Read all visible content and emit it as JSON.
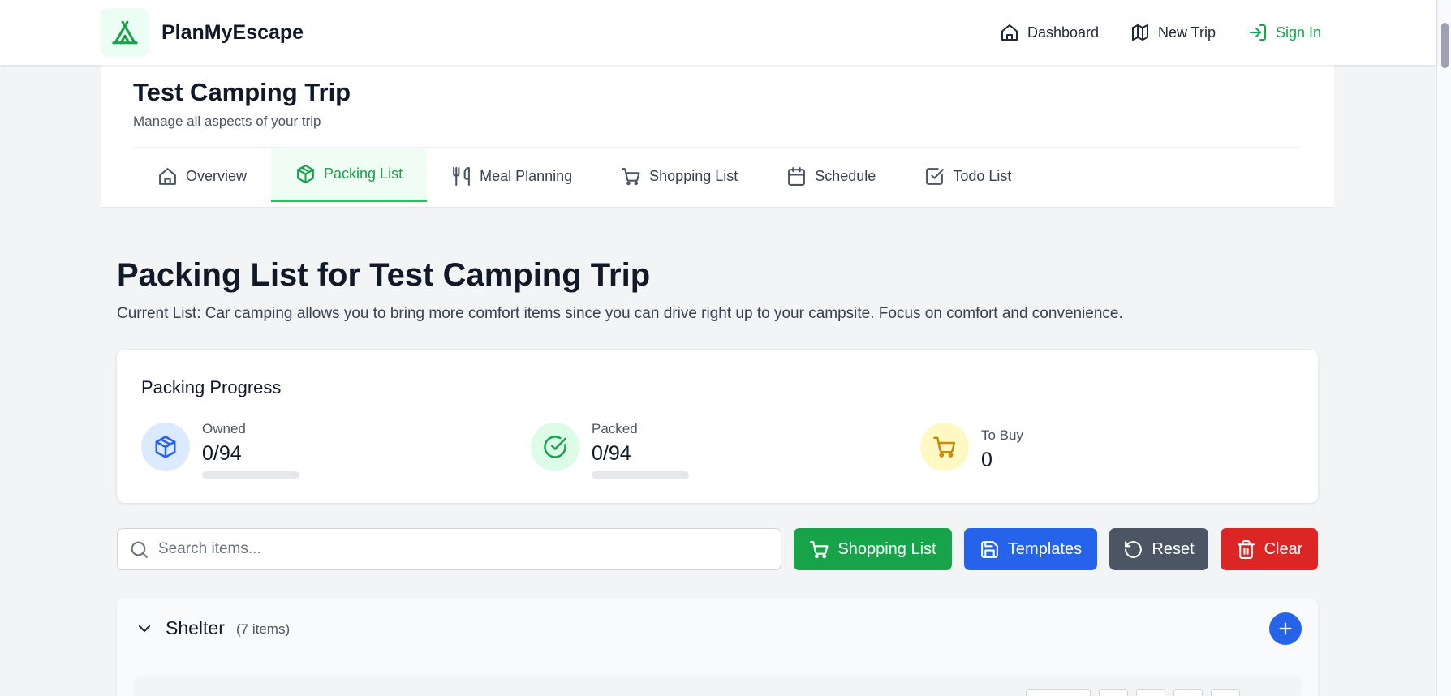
{
  "header": {
    "brand": "PlanMyEscape",
    "nav": [
      {
        "label": "Dashboard",
        "icon": "home-icon"
      },
      {
        "label": "New Trip",
        "icon": "map-icon"
      },
      {
        "label": "Sign In",
        "icon": "sign-in-icon"
      }
    ]
  },
  "trip": {
    "title": "Test Camping Trip",
    "subtitle": "Manage all aspects of your trip",
    "tabs": [
      {
        "label": "Overview",
        "icon": "home-icon"
      },
      {
        "label": "Packing List",
        "icon": "package-icon",
        "active": true
      },
      {
        "label": "Meal Planning",
        "icon": "utensils-icon"
      },
      {
        "label": "Shopping List",
        "icon": "cart-icon"
      },
      {
        "label": "Schedule",
        "icon": "calendar-icon"
      },
      {
        "label": "Todo List",
        "icon": "checkbox-icon"
      }
    ]
  },
  "main": {
    "heading": "Packing List for Test Camping Trip",
    "description": "Current List: Car camping allows you to bring more comfort items since you can drive right up to your campsite. Focus on comfort and convenience."
  },
  "progress": {
    "title": "Packing Progress",
    "owned": {
      "label": "Owned",
      "value": "0/94",
      "fraction": 0
    },
    "packed": {
      "label": "Packed",
      "value": "0/94",
      "fraction": 0
    },
    "to_buy": {
      "label": "To Buy",
      "value": "0"
    }
  },
  "toolbar": {
    "search_placeholder": "Search items...",
    "shopping_list_label": "Shopping List",
    "templates_label": "Templates",
    "reset_label": "Reset",
    "clear_label": "Clear"
  },
  "categories": [
    {
      "name": "Shelter",
      "count_label": "(7 items)"
    }
  ],
  "colors": {
    "brand_green": "#16a34a",
    "shopping_button": "#16a34a",
    "templates_button": "#2563eb",
    "reset_button": "#4b5563",
    "clear_button": "#dc2626",
    "add_button": "#2563eb"
  }
}
